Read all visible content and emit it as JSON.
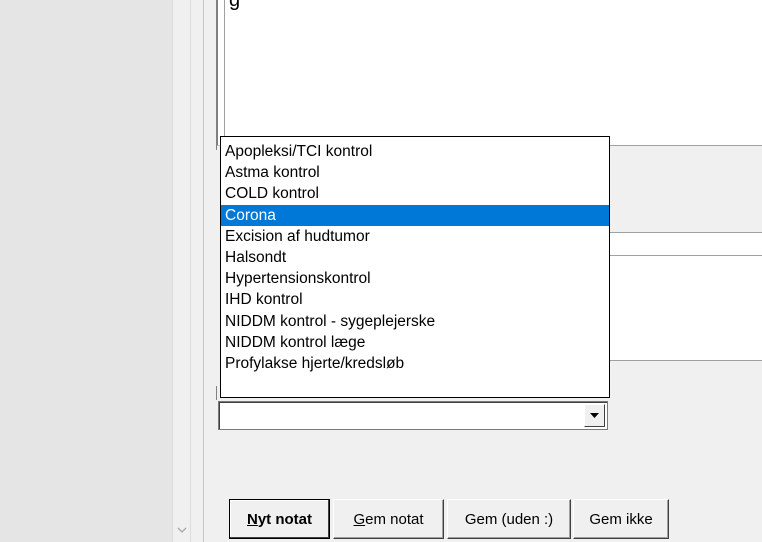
{
  "header": {
    "title_fragment": "g"
  },
  "note_type": {
    "selected_value": "",
    "options": [
      "Apopleksi/TCI kontrol",
      "Astma kontrol",
      "COLD kontrol",
      "Corona",
      "Excision af hudtumor",
      "Halsondt",
      "Hypertensionskontrol",
      "IHD kontrol",
      "NIDDM kontrol - sygeplejerske",
      "NIDDM kontrol læge",
      "Profylakse hjerte/kredsløb"
    ],
    "highlighted_option": "Corona"
  },
  "buttons": {
    "new_note": {
      "mnemonic": "N",
      "rest": "yt notat"
    },
    "save_note": {
      "mnemonic": "G",
      "rest": "em notat"
    },
    "save_without": "Gem (uden :)",
    "discard": "Gem ikke"
  },
  "icons": {
    "scroll_down": "chevron-down-icon",
    "combo_arrow": "triangle-down-icon"
  },
  "colors": {
    "selection": "#0078d7",
    "window_bg": "#f0f0f0"
  }
}
